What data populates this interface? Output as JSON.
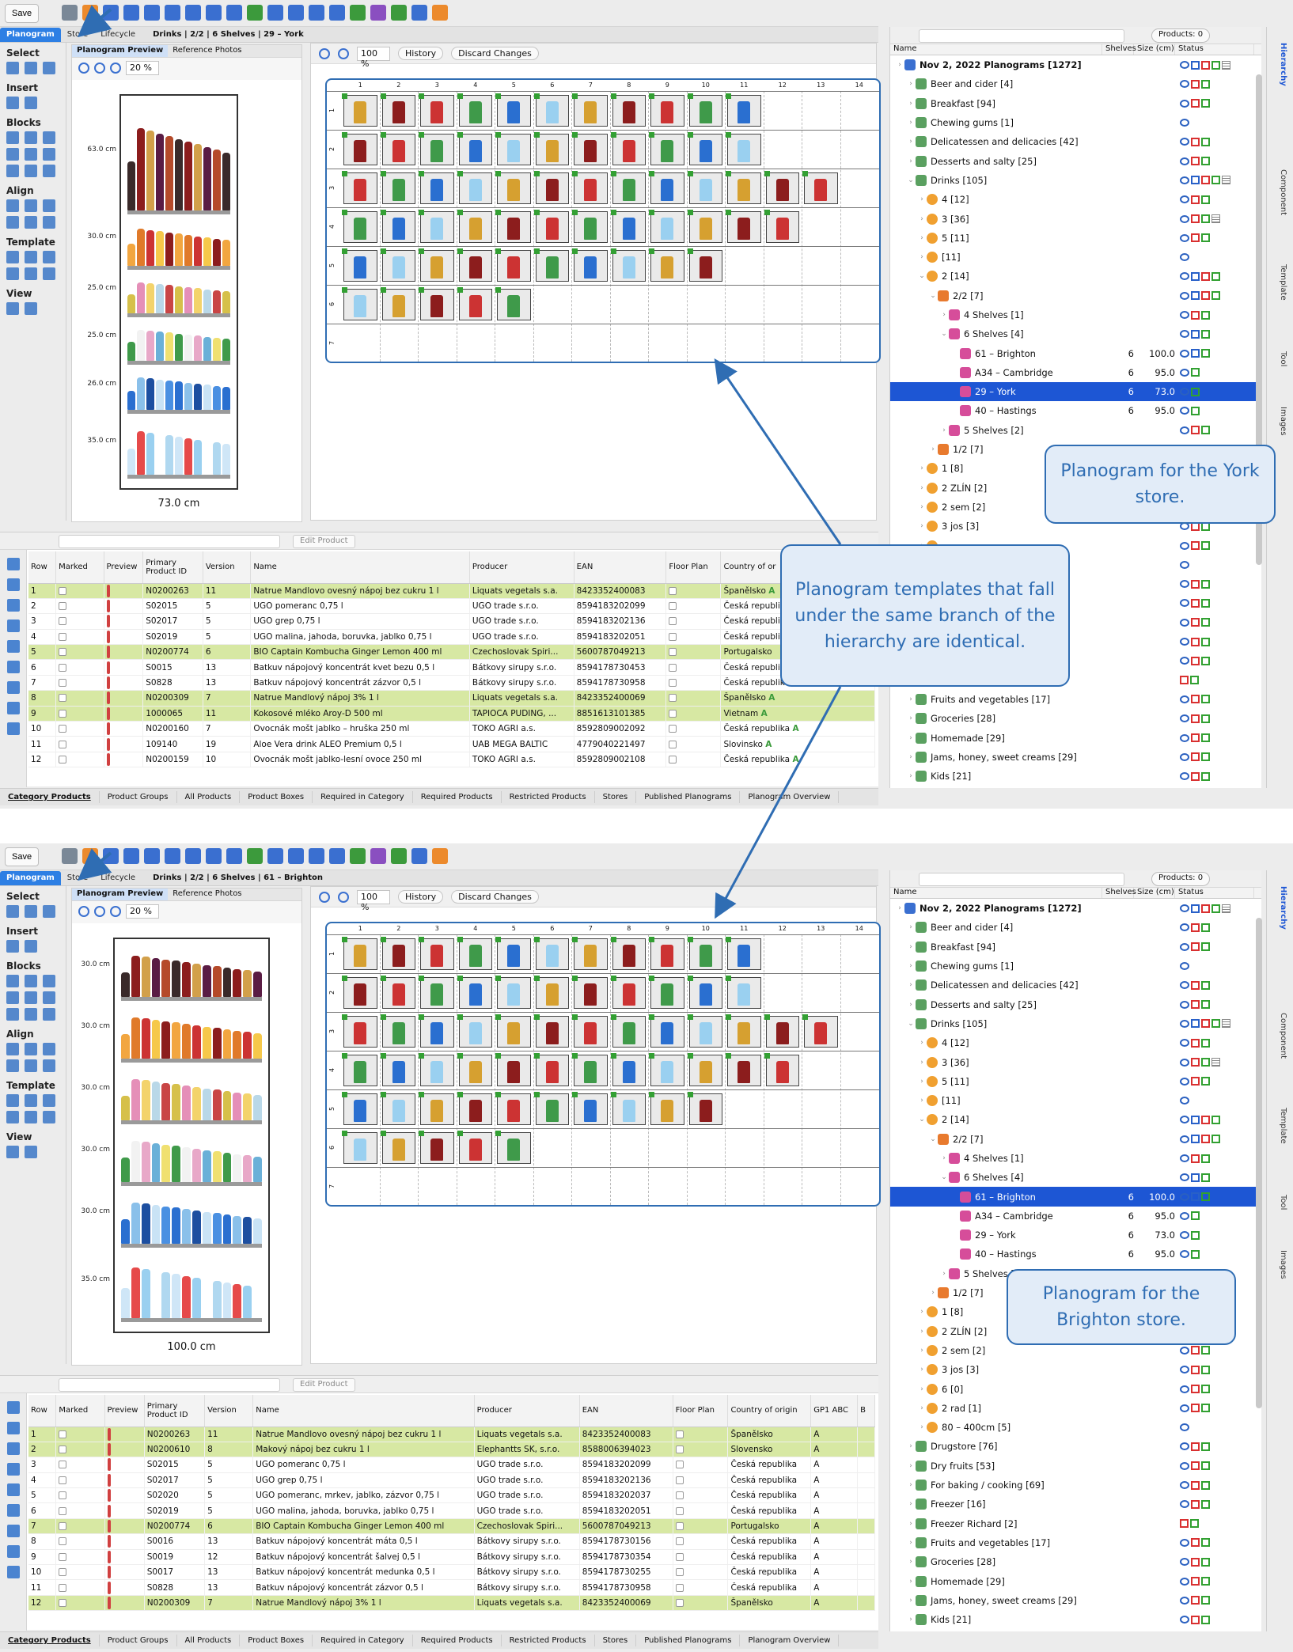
{
  "toolbar": {
    "save_label": "Save"
  },
  "tabs": {
    "planogram": "Planogram",
    "store": "Store",
    "lifecycle": "Lifecycle"
  },
  "shots": [
    {
      "breadcrumb": "Drinks | 2/2 | 6 Shelves | 29 – York",
      "width_label": "73.0 cm",
      "shelf_labels": [
        "63.0 cm",
        "30.0 cm",
        "25.0 cm",
        "25.0 cm",
        "26.0 cm",
        "35.0 cm"
      ],
      "selected_store": "29 – York"
    },
    {
      "breadcrumb": "Drinks | 2/2 | 6 Shelves | 61 – Brighton",
      "width_label": "100.0 cm",
      "shelf_labels": [
        "30.0 cm",
        "30.0 cm",
        "30.0 cm",
        "30.0 cm",
        "30.0 cm",
        "35.0 cm"
      ],
      "selected_store": "61 – Brighton"
    }
  ],
  "palette": {
    "select": "Select",
    "insert": "Insert",
    "blocks": "Blocks",
    "align": "Align",
    "template": "Template",
    "view": "View"
  },
  "preview": {
    "tab_preview": "Planogram Preview",
    "tab_photos": "Reference Photos",
    "zoom": "20 %"
  },
  "editor": {
    "zoom": "100 %",
    "history": "History",
    "discard": "Discard Changes",
    "columns": [
      "1",
      "2",
      "3",
      "4",
      "5",
      "6",
      "7",
      "8",
      "9",
      "10",
      "11",
      "12",
      "13",
      "14"
    ],
    "rows": [
      "1",
      "2",
      "3",
      "4",
      "5",
      "6",
      "7"
    ]
  },
  "products": {
    "edit_label": "Edit Product",
    "headers1": [
      "Row",
      "Marked",
      "Preview",
      "Primary Product ID",
      "Version",
      "Name",
      "Producer",
      "EAN",
      "Floor Plan",
      "Country of or"
    ],
    "headers2": [
      "Row",
      "Marked",
      "Preview",
      "Primary Product ID",
      "Version",
      "Name",
      "Producer",
      "EAN",
      "Floor Plan",
      "Country of origin",
      "GP1 ABC",
      "B"
    ],
    "rows1": [
      [
        "1",
        "",
        "",
        "N0200263",
        "11",
        "Natrue Mandlovo ovesný nápoj bez cukru 1 l",
        "Liquats vegetals s.a.",
        "8423352400083",
        "",
        "Španělsko",
        "A"
      ],
      [
        "2",
        "",
        "",
        "S02015",
        "5",
        "UGO pomeranc 0,75 l",
        "UGO trade s.r.o.",
        "8594183202099",
        "",
        "Česká republi",
        ""
      ],
      [
        "3",
        "",
        "",
        "S02017",
        "5",
        "UGO grep 0,75 l",
        "UGO trade s.r.o.",
        "8594183202136",
        "",
        "Česká republi",
        ""
      ],
      [
        "4",
        "",
        "",
        "S02019",
        "5",
        "UGO malina, jahoda, boruvka, jablko 0,75 l",
        "UGO trade s.r.o.",
        "8594183202051",
        "",
        "Česká republi",
        ""
      ],
      [
        "5",
        "",
        "",
        "N0200774",
        "6",
        "BIO Captain Kombucha Ginger Lemon 400 ml",
        "Czechoslovak Spiri...",
        "5600787049213",
        "",
        "Portugalsko",
        ""
      ],
      [
        "6",
        "",
        "",
        "S0015",
        "13",
        "Batkuv nápojový koncentrát kvet bezu 0,5 l",
        "Bátkovy sirupy s.r.o.",
        "8594178730453",
        "",
        "Česká republi",
        ""
      ],
      [
        "7",
        "",
        "",
        "S0828",
        "13",
        "Batkuv nápojový koncentrát zázvor 0,5 l",
        "Bátkovy sirupy s.r.o.",
        "8594178730958",
        "",
        "Česká republika",
        "A"
      ],
      [
        "8",
        "",
        "",
        "N0200309",
        "7",
        "Natrue Mandlový nápoj 3% 1 l",
        "Liquats vegetals s.a.",
        "8423352400069",
        "",
        "Španělsko",
        "A"
      ],
      [
        "9",
        "",
        "",
        "1000065",
        "11",
        "Kokosové mléko Aroy-D 500 ml",
        "TAPIOCA PUDING, ...",
        "8851613101385",
        "",
        "Vietnam",
        "A"
      ],
      [
        "10",
        "",
        "",
        "N0200160",
        "7",
        "Ovocnák mošt jablko – hruška 250 ml",
        "TOKO AGRI a.s.",
        "8592809002092",
        "",
        "Česká republika",
        "A"
      ],
      [
        "11",
        "",
        "",
        "109140",
        "19",
        "Aloe Vera drink ALEO Premium 0,5 l",
        "UAB MEGA BALTIC",
        "4779040221497",
        "",
        "Slovinsko",
        "A"
      ],
      [
        "12",
        "",
        "",
        "N0200159",
        "10",
        "Ovocnák mošt jablko-lesní ovoce 250 ml",
        "TOKO AGRI a.s.",
        "8592809002108",
        "",
        "Česká republika",
        "A"
      ]
    ],
    "rows2": [
      [
        "1",
        "",
        "",
        "N0200263",
        "11",
        "Natrue Mandlovo ovesný nápoj bez cukru 1 l",
        "Liquats vegetals s.a.",
        "8423352400083",
        "",
        "Španělsko",
        "A"
      ],
      [
        "2",
        "",
        "",
        "N0200610",
        "8",
        "Makový nápoj bez cukru 1 l",
        "Elephantts SK, s.r.o.",
        "8588006394023",
        "",
        "Slovensko",
        "A"
      ],
      [
        "3",
        "",
        "",
        "S02015",
        "5",
        "UGO pomeranc 0,75 l",
        "UGO trade s.r.o.",
        "8594183202099",
        "",
        "Česká republika",
        "A"
      ],
      [
        "4",
        "",
        "",
        "S02017",
        "5",
        "UGO grep 0,75 l",
        "UGO trade s.r.o.",
        "8594183202136",
        "",
        "Česká republika",
        "A"
      ],
      [
        "5",
        "",
        "",
        "S02020",
        "5",
        "UGO pomeranc, mrkev, jablko, zázvor 0,75 l",
        "UGO trade s.r.o.",
        "8594183202037",
        "",
        "Česká republika",
        "A"
      ],
      [
        "6",
        "",
        "",
        "S02019",
        "5",
        "UGO malina, jahoda, boruvka, jablko 0,75 l",
        "UGO trade s.r.o.",
        "8594183202051",
        "",
        "Česká republika",
        "A"
      ],
      [
        "7",
        "",
        "",
        "N0200774",
        "6",
        "BIO Captain Kombucha Ginger Lemon 400 ml",
        "Czechoslovak Spiri...",
        "5600787049213",
        "",
        "Portugalsko",
        "A"
      ],
      [
        "8",
        "",
        "",
        "S0016",
        "13",
        "Batkuv nápojový koncentrát máta 0,5 l",
        "Bátkovy sirupy s.r.o.",
        "8594178730156",
        "",
        "Česká republika",
        "A"
      ],
      [
        "9",
        "",
        "",
        "S0019",
        "12",
        "Batkuv nápojový koncentrát šalvej 0,5 l",
        "Bátkovy sirupy s.r.o.",
        "8594178730354",
        "",
        "Česká republika",
        "A"
      ],
      [
        "10",
        "",
        "",
        "S0017",
        "13",
        "Batkuv nápojový koncentrát medunka 0,5 l",
        "Bátkovy sirupy s.r.o.",
        "8594178730255",
        "",
        "Česká republika",
        "A"
      ],
      [
        "11",
        "",
        "",
        "S0828",
        "13",
        "Batkuv nápojový koncentrát zázvor 0,5 l",
        "Bátkovy sirupy s.r.o.",
        "8594178730958",
        "",
        "Česká republika",
        "A"
      ],
      [
        "12",
        "",
        "",
        "N0200309",
        "7",
        "Natrue Mandlový nápoj 3% 1 l",
        "Liquats vegetals s.a.",
        "8423352400069",
        "",
        "Španělsko",
        "A"
      ]
    ]
  },
  "bottom_tabs": [
    "Category Products",
    "Product Groups",
    "All Products",
    "Product Boxes",
    "Required in Category",
    "Required Products",
    "Restricted Products",
    "Stores",
    "Published Planograms",
    "Planogram Overview"
  ],
  "hierarchy": {
    "products_badge": "Products: 0",
    "headers": [
      "Name",
      "Shelves",
      "Size (cm)",
      "Status"
    ],
    "vtabs": [
      "Hierarchy",
      "Component",
      "Template",
      "Tool",
      "Images"
    ],
    "tree1": [
      {
        "lvl": 0,
        "icon": "pg",
        "label": "Nov 2, 2022 Planograms [1272]",
        "st": "lbrgk",
        "bold": true
      },
      {
        "lvl": 1,
        "icon": "tree",
        "label": "Beer and cider [4]",
        "st": "lrg"
      },
      {
        "lvl": 1,
        "icon": "tree",
        "label": "Breakfast [94]",
        "st": "lrg"
      },
      {
        "lvl": 1,
        "icon": "tree",
        "label": "Chewing gums [1]",
        "st": "l"
      },
      {
        "lvl": 1,
        "icon": "tree",
        "label": "Delicatessen and delicacies [42]",
        "st": "lrg"
      },
      {
        "lvl": 1,
        "icon": "tree",
        "label": "Desserts and salty [25]",
        "st": "lrg"
      },
      {
        "lvl": 1,
        "icon": "tree",
        "label": "Drinks [105]",
        "st": "lbrgk",
        "open": true
      },
      {
        "lvl": 2,
        "icon": "gear",
        "label": "4 [12]",
        "st": "lrg"
      },
      {
        "lvl": 2,
        "icon": "gear",
        "label": "3 [36]",
        "st": "lrgk"
      },
      {
        "lvl": 2,
        "icon": "gear",
        "label": "5 [11]",
        "st": "lrg"
      },
      {
        "lvl": 2,
        "icon": "gear",
        "label": "[11]",
        "st": "l"
      },
      {
        "lvl": 2,
        "icon": "gear",
        "label": "2 [14]",
        "st": "lbrg",
        "open": true
      },
      {
        "lvl": 3,
        "icon": "bag",
        "label": "2/2 [7]",
        "st": "lbrg",
        "open": true
      },
      {
        "lvl": 4,
        "icon": "store",
        "label": "4 Shelves [1]",
        "st": "lrg"
      },
      {
        "lvl": 4,
        "icon": "store",
        "label": "6 Shelves [4]",
        "st": "lbg",
        "open": true
      },
      {
        "lvl": 5,
        "icon": "store",
        "label": "61 – Brighton",
        "shelves": "6",
        "size": "100.0",
        "st": "lbg"
      },
      {
        "lvl": 5,
        "icon": "store",
        "label": "A34 – Cambridge",
        "shelves": "6",
        "size": "95.0",
        "st": "lg"
      },
      {
        "lvl": 5,
        "icon": "store",
        "label": "29 – York",
        "shelves": "6",
        "size": "73.0",
        "st": "lg",
        "sel": true
      },
      {
        "lvl": 5,
        "icon": "store",
        "label": "40 – Hastings",
        "shelves": "6",
        "size": "95.0",
        "st": "lg"
      },
      {
        "lvl": 4,
        "icon": "store",
        "label": "5 Shelves [2]",
        "st": "lrg"
      },
      {
        "lvl": 3,
        "icon": "bag",
        "label": "1/2 [7]",
        "st": "lrg"
      },
      {
        "lvl": 2,
        "icon": "gear",
        "label": "1 [8]",
        "st": "lrg"
      },
      {
        "lvl": 2,
        "icon": "gear",
        "label": "2 ZLÍN [2]",
        "st": "lrg"
      },
      {
        "lvl": 2,
        "icon": "gear",
        "label": "2 sem [2]",
        "st": "lrg"
      },
      {
        "lvl": 2,
        "icon": "gear",
        "label": "3 jos [3]",
        "st": "lrg"
      },
      {
        "lvl": 2,
        "icon": "gear",
        "label": "",
        "st": "lrg"
      },
      {
        "lvl": 2,
        "icon": "gear",
        "label": "",
        "st": "l"
      },
      {
        "lvl": 2,
        "icon": "gear",
        "label": "",
        "st": "lrg"
      },
      {
        "lvl": 2,
        "icon": "gear",
        "label": "",
        "st": "lrg"
      },
      {
        "lvl": 2,
        "icon": "gear",
        "label": "",
        "st": "lrg"
      },
      {
        "lvl": 2,
        "icon": "gear",
        "label": "",
        "st": "lrg"
      },
      {
        "lvl": 2,
        "icon": "gear",
        "label": "",
        "st": "lrg"
      },
      {
        "lvl": 2,
        "icon": "gear",
        "label": "",
        "st": "rg"
      },
      {
        "lvl": 1,
        "icon": "tree",
        "label": "Fruits and vegetables [17]",
        "st": "lrg"
      },
      {
        "lvl": 1,
        "icon": "tree",
        "label": "Groceries [28]",
        "st": "lrg"
      },
      {
        "lvl": 1,
        "icon": "tree",
        "label": "Homemade [29]",
        "st": "lrg"
      },
      {
        "lvl": 1,
        "icon": "tree",
        "label": "Jams, honey, sweet creams [29]",
        "st": "lrg"
      },
      {
        "lvl": 1,
        "icon": "tree",
        "label": "Kids [21]",
        "st": "lrg"
      }
    ],
    "tree2": [
      {
        "lvl": 0,
        "icon": "pg",
        "label": "Nov 2, 2022 Planograms [1272]",
        "st": "lbrgk",
        "bold": true
      },
      {
        "lvl": 1,
        "icon": "tree",
        "label": "Beer and cider [4]",
        "st": "lrg"
      },
      {
        "lvl": 1,
        "icon": "tree",
        "label": "Breakfast [94]",
        "st": "lrg"
      },
      {
        "lvl": 1,
        "icon": "tree",
        "label": "Chewing gums [1]",
        "st": "l"
      },
      {
        "lvl": 1,
        "icon": "tree",
        "label": "Delicatessen and delicacies [42]",
        "st": "lrg"
      },
      {
        "lvl": 1,
        "icon": "tree",
        "label": "Desserts and salty [25]",
        "st": "lrg"
      },
      {
        "lvl": 1,
        "icon": "tree",
        "label": "Drinks [105]",
        "st": "lbrgk",
        "open": true
      },
      {
        "lvl": 2,
        "icon": "gear",
        "label": "4 [12]",
        "st": "lrg"
      },
      {
        "lvl": 2,
        "icon": "gear",
        "label": "3 [36]",
        "st": "lrgk"
      },
      {
        "lvl": 2,
        "icon": "gear",
        "label": "5 [11]",
        "st": "lrg"
      },
      {
        "lvl": 2,
        "icon": "gear",
        "label": "[11]",
        "st": "l"
      },
      {
        "lvl": 2,
        "icon": "gear",
        "label": "2 [14]",
        "st": "lbrg",
        "open": true
      },
      {
        "lvl": 3,
        "icon": "bag",
        "label": "2/2 [7]",
        "st": "lbrg",
        "open": true
      },
      {
        "lvl": 4,
        "icon": "store",
        "label": "4 Shelves [1]",
        "st": "lrg"
      },
      {
        "lvl": 4,
        "icon": "store",
        "label": "6 Shelves [4]",
        "st": "lbg",
        "open": true
      },
      {
        "lvl": 5,
        "icon": "store",
        "label": "61 – Brighton",
        "shelves": "6",
        "size": "100.0",
        "st": "lbg",
        "sel": true
      },
      {
        "lvl": 5,
        "icon": "store",
        "label": "A34 – Cambridge",
        "shelves": "6",
        "size": "95.0",
        "st": "lg"
      },
      {
        "lvl": 5,
        "icon": "store",
        "label": "29 – York",
        "shelves": "6",
        "size": "73.0",
        "st": "lg"
      },
      {
        "lvl": 5,
        "icon": "store",
        "label": "40 – Hastings",
        "shelves": "6",
        "size": "95.0",
        "st": "lg"
      },
      {
        "lvl": 4,
        "icon": "store",
        "label": "5 Shelves [2]",
        "st": "lrg"
      },
      {
        "lvl": 3,
        "icon": "bag",
        "label": "1/2 [7]",
        "st": "lrg"
      },
      {
        "lvl": 2,
        "icon": "gear",
        "label": "1 [8]",
        "st": "lrg"
      },
      {
        "lvl": 2,
        "icon": "gear",
        "label": "2 ZLÍN [2]",
        "st": "lrg"
      },
      {
        "lvl": 2,
        "icon": "gear",
        "label": "2 sem [2]",
        "st": "lrg"
      },
      {
        "lvl": 2,
        "icon": "gear",
        "label": "3 jos [3]",
        "st": "lrg"
      },
      {
        "lvl": 2,
        "icon": "gear",
        "label": "6 [0]",
        "st": "lrg"
      },
      {
        "lvl": 2,
        "icon": "gear",
        "label": "2 rad [1]",
        "st": "lrg"
      },
      {
        "lvl": 2,
        "icon": "gear",
        "label": "80 – 400cm [5]",
        "st": "l"
      },
      {
        "lvl": 1,
        "icon": "tree",
        "label": "Drugstore [76]",
        "st": "lrg"
      },
      {
        "lvl": 1,
        "icon": "tree",
        "label": "Dry fruits [53]",
        "st": "lrg"
      },
      {
        "lvl": 1,
        "icon": "tree",
        "label": "For baking / cooking [69]",
        "st": "lrg"
      },
      {
        "lvl": 1,
        "icon": "tree",
        "label": "Freezer [16]",
        "st": "lrg"
      },
      {
        "lvl": 1,
        "icon": "tree",
        "label": "Freezer Richard [2]",
        "st": "rg"
      },
      {
        "lvl": 1,
        "icon": "tree",
        "label": "Fruits and vegetables [17]",
        "st": "lrg"
      },
      {
        "lvl": 1,
        "icon": "tree",
        "label": "Groceries [28]",
        "st": "lrg"
      },
      {
        "lvl": 1,
        "icon": "tree",
        "label": "Homemade [29]",
        "st": "lrg"
      },
      {
        "lvl": 1,
        "icon": "tree",
        "label": "Jams, honey, sweet creams [29]",
        "st": "lrg"
      },
      {
        "lvl": 1,
        "icon": "tree",
        "label": "Kids [21]",
        "st": "lrg"
      }
    ]
  },
  "callouts": {
    "york": "Planogram for the York store.",
    "templates": "Planogram templates that fall under the same branch of the hierarchy are identical.",
    "brighton": "Planogram for the Brighton store."
  },
  "colors": {
    "accent": "#2f6db3",
    "selection": "#1d56d4",
    "highlight_row": "#d7e8a3"
  }
}
